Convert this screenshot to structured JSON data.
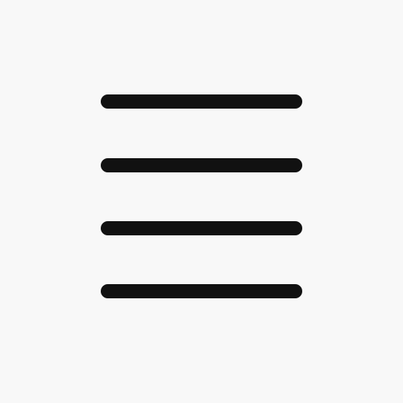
{
  "icon": {
    "name": "hamburger-menu-icon",
    "line_count": 4
  },
  "colors": {
    "background": "#f8f8f8",
    "icon": "#111111"
  }
}
